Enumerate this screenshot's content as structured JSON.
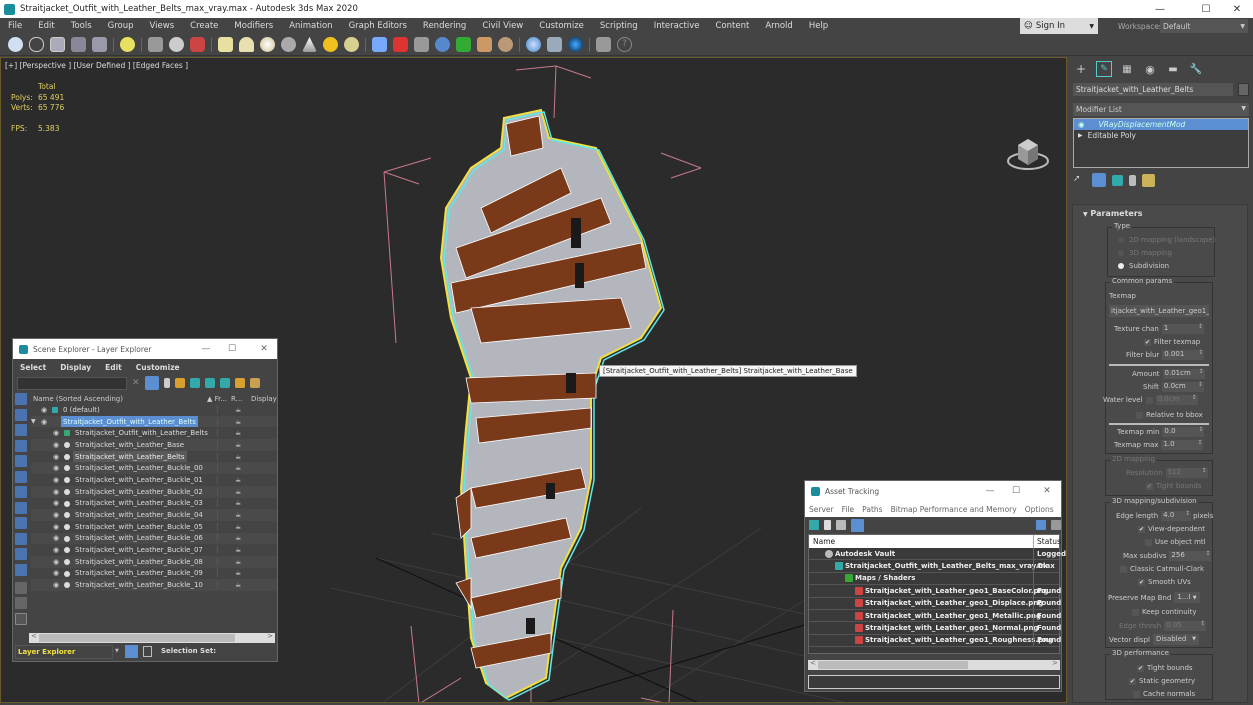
{
  "window": {
    "title": "Straitjacket_Outfit_with_Leather_Belts_max_vray.max - Autodesk 3ds Max 2020",
    "controls": {
      "minimize": "—",
      "maximize": "☐",
      "close": "✕"
    }
  },
  "menubar": {
    "items": [
      "File",
      "Edit",
      "Tools",
      "Group",
      "Views",
      "Create",
      "Modifiers",
      "Animation",
      "Graph Editors",
      "Rendering",
      "Civil View",
      "Customize",
      "Scripting",
      "Interactive",
      "Content",
      "Arnold",
      "Help"
    ],
    "sign_in": "Sign In",
    "workspaces_label": "Workspaces:",
    "workspaces_value": "Default"
  },
  "toolbar": {
    "icons": [
      "teapot-icon",
      "cloud-icon",
      "render-frame-icon",
      "scene-explorer-icon",
      "layer-explorer-icon",
      "light-icon",
      "camera-icon",
      "sphere-half-icon",
      "render-setup-icon",
      "plane-icon",
      "dome-icon",
      "sphere-icon",
      "teapot2-icon",
      "cone-icon",
      "sun-icon",
      "disc-icon",
      "particles-icon",
      "molecule-icon",
      "tripod-icon",
      "globe-icon",
      "grass-icon",
      "animal-icon",
      "hair-icon",
      "material-ball-icon",
      "asset-icon",
      "render-icon",
      "clipboard-icon",
      "help-icon"
    ]
  },
  "viewport": {
    "label": "[+] [Perspective ] [User Defined ] [Edged Faces ]",
    "stats": {
      "header": "Total",
      "polys_label": "Polys:",
      "polys_value": "65 491",
      "verts_label": "Verts:",
      "verts_value": "65 776",
      "fps_label": "FPS:",
      "fps_value": "5.383"
    },
    "tooltip": "[Straitjacket_Outfit_with_Leather_Belts] Straitjacket_with_Leather_Base"
  },
  "command_panel": {
    "object_name": "Straitjacket_with_Leather_Belts",
    "modifier_list": "Modifier List",
    "stack": [
      {
        "label": "VRayDisplacementMod",
        "selected": true
      },
      {
        "label": "Editable Poly",
        "selected": false
      }
    ],
    "rollout_title": "Parameters",
    "type": {
      "title": "Type",
      "options": [
        "2D mapping (landscape)",
        "3D mapping",
        "Subdivision"
      ],
      "selected": "Subdivision"
    },
    "common_params": {
      "title": "Common params",
      "texmap_label": "Texmap",
      "texmap_value": "itjacket_with_Leather_geo1_",
      "texture_chan_label": "Texture chan",
      "texture_chan_value": "1",
      "filter_texmap_label": "Filter texmap",
      "filter_texmap_checked": true,
      "filter_blur_label": "Filter blur",
      "filter_blur_value": "0.001",
      "amount_label": "Amount",
      "amount_value": "0.01cm",
      "shift_label": "Shift",
      "shift_value": "0.0cm",
      "water_level_label": "Water level",
      "water_level_value": "0.0cm",
      "relative_bbox_label": "Relative to bbox",
      "texmap_min_label": "Texmap min",
      "texmap_min_value": "0.0",
      "texmap_max_label": "Texmap max",
      "texmap_max_value": "1.0"
    },
    "mapping_2d": {
      "title": "2D mapping",
      "resolution_label": "Resolution",
      "resolution_value": "512",
      "tight_bounds_label": "Tight bounds"
    },
    "mapping_3d": {
      "title": "3D mapping/subdivision",
      "edge_length_label": "Edge length",
      "edge_length_value": "4.0",
      "edge_length_unit": "pixels",
      "view_dependent_label": "View-dependent",
      "use_object_mtl_label": "Use object mtl",
      "max_subdivs_label": "Max subdivs",
      "max_subdivs_value": "256",
      "classic_cc_label": "Classic Catmull-Clark",
      "smooth_uvs_label": "Smooth UVs",
      "preserve_map_label": "Preserve Map Bnd",
      "preserve_map_value": "1...I",
      "keep_continuity_label": "Keep continuity",
      "edge_thresh_label": "Edge thresh",
      "edge_thresh_value": "0.05",
      "vector_displ_label": "Vector displ",
      "vector_displ_value": "Disabled"
    },
    "performance_3d": {
      "title": "3D performance",
      "tight_bounds_label": "Tight bounds",
      "static_geometry_label": "Static geometry",
      "cache_normals_label": "Cache normals"
    }
  },
  "scene_explorer": {
    "title": "Scene Explorer - Layer Explorer",
    "menu": [
      "Select",
      "Display",
      "Edit",
      "Customize"
    ],
    "columns": {
      "name": "Name (Sorted Ascending)",
      "frozen": "▲ Fr...",
      "render": "R...",
      "display": "Display"
    },
    "rows": [
      {
        "name": "0 (default)",
        "level": 0,
        "type": "layer"
      },
      {
        "name": "Straitjacket_Outfit_with_Leather_Belts",
        "level": 0,
        "type": "layer-active"
      },
      {
        "name": "Straitjacket_Outfit_with_Leather_Belts",
        "level": 1,
        "type": "group"
      },
      {
        "name": "Straitjacket_with_Leather_Base",
        "level": 1,
        "type": "object"
      },
      {
        "name": "Straitjacket_with_Leather_Belts",
        "level": 1,
        "type": "object",
        "selected": true
      },
      {
        "name": "Straitjacket_with_Leather_Buckle_00",
        "level": 1,
        "type": "object"
      },
      {
        "name": "Straitjacket_with_Leather_Buckle_01",
        "level": 1,
        "type": "object"
      },
      {
        "name": "Straitjacket_with_Leather_Buckle_02",
        "level": 1,
        "type": "object"
      },
      {
        "name": "Straitjacket_with_Leather_Buckle_03",
        "level": 1,
        "type": "object"
      },
      {
        "name": "Straitjacket_with_Leather_Buckle_04",
        "level": 1,
        "type": "object"
      },
      {
        "name": "Straitjacket_with_Leather_Buckle_05",
        "level": 1,
        "type": "object"
      },
      {
        "name": "Straitjacket_with_Leather_Buckle_06",
        "level": 1,
        "type": "object"
      },
      {
        "name": "Straitjacket_with_Leather_Buckle_07",
        "level": 1,
        "type": "object"
      },
      {
        "name": "Straitjacket_with_Leather_Buckle_08",
        "level": 1,
        "type": "object"
      },
      {
        "name": "Straitjacket_with_Leather_Buckle_09",
        "level": 1,
        "type": "object"
      },
      {
        "name": "Straitjacket_with_Leather_Buckle_10",
        "level": 1,
        "type": "object"
      }
    ],
    "footer_mode": "Layer Explorer",
    "selection_set_label": "Selection Set:"
  },
  "asset_tracking": {
    "title": "Asset Tracking",
    "menu": [
      "Server",
      "File",
      "Paths",
      "Bitmap Performance and Memory",
      "Options"
    ],
    "columns": {
      "name": "Name",
      "status": "Status"
    },
    "rows": [
      {
        "name": "Autodesk Vault",
        "status": "Logged",
        "level": 1,
        "icon": "vault-icon"
      },
      {
        "name": "Straitjacket_Outfit_with_Leather_Belts_max_vray.max",
        "status": "Ok",
        "level": 2,
        "icon": "max-file-icon"
      },
      {
        "name": "Maps / Shaders",
        "status": "",
        "level": 3,
        "icon": "maps-icon"
      },
      {
        "name": "Straitjacket_with_Leather_geo1_BaseColor.png",
        "status": "Found",
        "level": 4,
        "icon": "png-icon"
      },
      {
        "name": "Straitjacket_with_Leather_geo1_Displace.png",
        "status": "Found",
        "level": 4,
        "icon": "png-icon"
      },
      {
        "name": "Straitjacket_with_Leather_geo1_Metallic.png",
        "status": "Found",
        "level": 4,
        "icon": "png-icon"
      },
      {
        "name": "Straitjacket_with_Leather_geo1_Normal.png",
        "status": "Found",
        "level": 4,
        "icon": "png-icon"
      },
      {
        "name": "Straitjacket_with_Leather_geo1_Roughness.png",
        "status": "Found",
        "level": 4,
        "icon": "png-icon"
      }
    ]
  },
  "colors": {
    "accent_blue": "#5b8fd1",
    "stats_yellow": "#e0d060",
    "selection_cyan": "#5ee8e8",
    "belt_brown": "#7a3a1a",
    "layer_yellow": "#f0e040"
  }
}
